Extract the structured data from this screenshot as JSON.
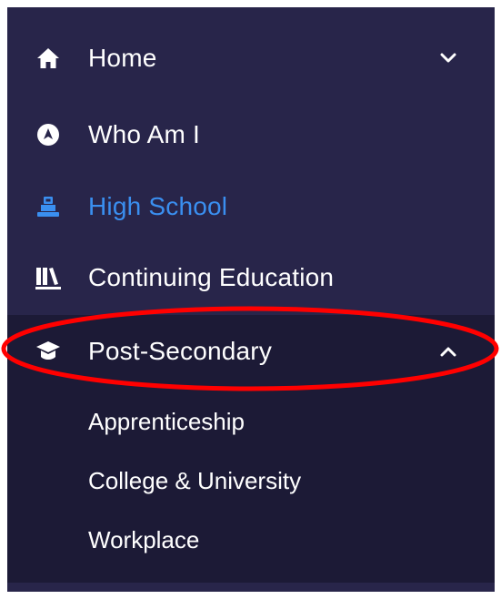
{
  "nav": {
    "items": [
      {
        "label": "Home",
        "icon": "home-icon",
        "chevron": "down"
      },
      {
        "label": "Who Am I",
        "icon": "compass-icon"
      },
      {
        "label": "High School",
        "icon": "school-icon",
        "active": true
      },
      {
        "label": "Continuing Education",
        "icon": "books-icon"
      },
      {
        "label": "Post-Secondary",
        "icon": "graduation-cap-icon",
        "chevron": "up",
        "expanded": true
      }
    ],
    "subitems": [
      {
        "label": "Apprenticeship"
      },
      {
        "label": "College & University"
      },
      {
        "label": "Workplace"
      }
    ]
  },
  "colors": {
    "panel": "#28254a",
    "submenu": "#1c1a36",
    "active_text": "#3a8ff0",
    "annotation": "#ff0000"
  }
}
